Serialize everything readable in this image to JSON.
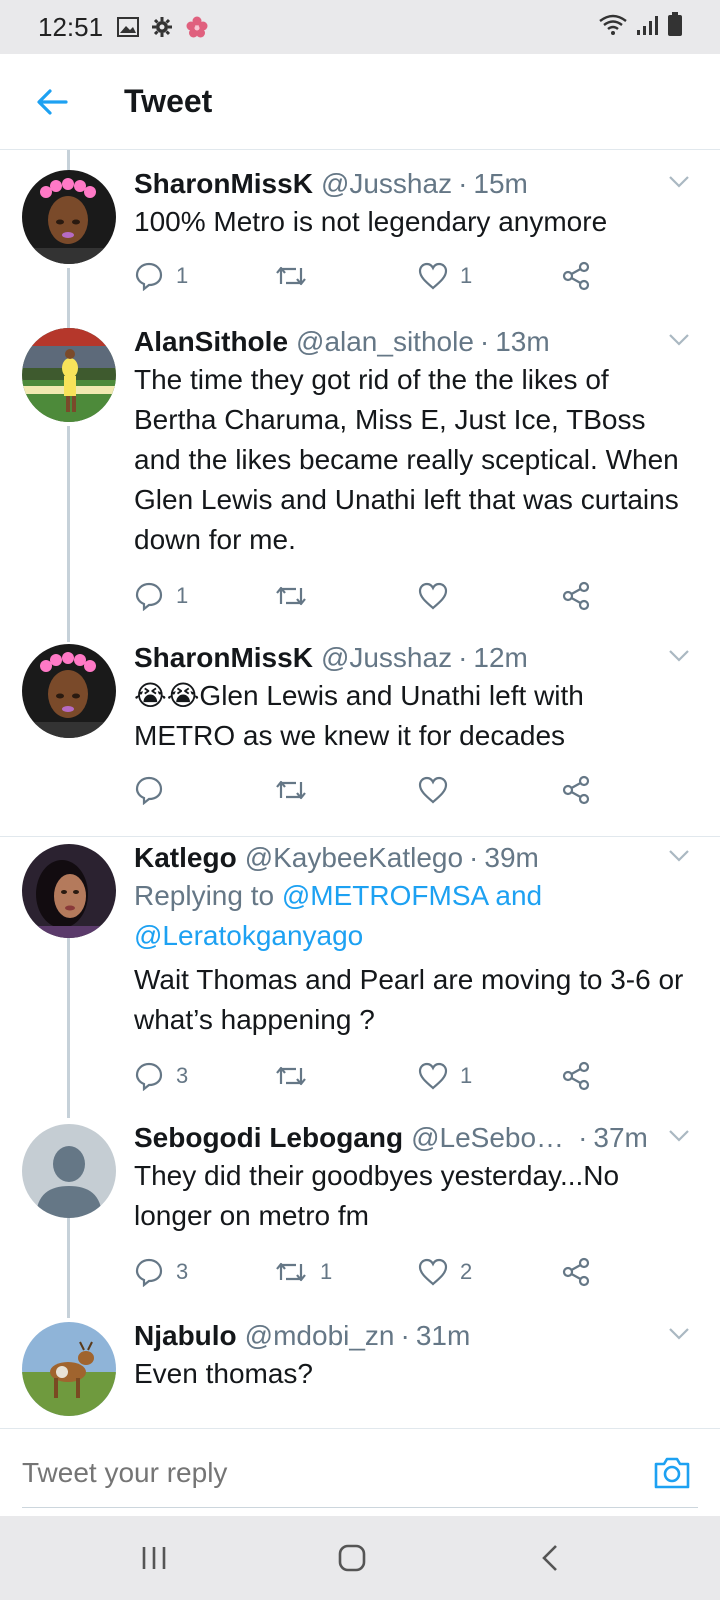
{
  "status_bar": {
    "time": "12:51",
    "icons": [
      "gallery-icon",
      "gear-icon",
      "flower-icon",
      "wifi-icon",
      "signal-icon",
      "battery-icon"
    ]
  },
  "header": {
    "title": "Tweet"
  },
  "tweets": [
    {
      "name": "SharonMissK",
      "handle": "@Jusshaz",
      "time": "15m",
      "text": "100% Metro is not legendary anymore",
      "replies": "1",
      "retweets": "",
      "likes": "1"
    },
    {
      "name": "AlanSithole",
      "handle": "@alan_sithole",
      "time": "13m",
      "text": "The time they got rid of the the likes of Bertha Charuma, Miss E, Just Ice, TBoss and the likes became really sceptical. When Glen Lewis and Unathi left that was curtains down for me.",
      "replies": "1",
      "retweets": "",
      "likes": ""
    },
    {
      "name": "SharonMissK",
      "handle": "@Jusshaz",
      "time": "12m",
      "text": "😭😭Glen Lewis and Unathi left with METRO as we knew it for decades",
      "replies": "",
      "retweets": "",
      "likes": ""
    },
    {
      "name": "Katlego",
      "handle": "@KaybeeKatlego",
      "time": "39m",
      "replying_prefix": "Replying to ",
      "replying_users": "@METROFMSA and @Leratokganyago",
      "text": "Wait Thomas and Pearl are moving to 3-6 or what’s happening ?",
      "replies": "3",
      "retweets": "",
      "likes": "1"
    },
    {
      "name": "Sebogodi Lebogang",
      "handle": "@LeSebo…",
      "time": "37m",
      "text": "They did their goodbyes yesterday...No longer on metro fm",
      "replies": "3",
      "retweets": "1",
      "likes": "2"
    },
    {
      "name": "Njabulo",
      "handle": "@mdobi_zn",
      "time": "31m",
      "text": "Even thomas?"
    }
  ],
  "reply_bar": {
    "placeholder": "Tweet your reply"
  },
  "colors": {
    "accent": "#1da1f2",
    "secondary_text": "#657786",
    "primary_text": "#14171a"
  }
}
